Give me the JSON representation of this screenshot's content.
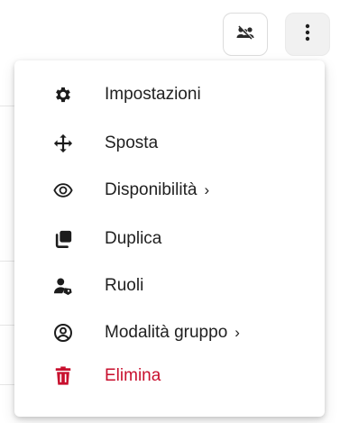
{
  "toolbar": {
    "groups_icon": "groups-off-icon",
    "more_icon": "more-vertical-icon"
  },
  "menu": {
    "items": [
      {
        "label": "Impostazioni",
        "icon": "gear-icon"
      },
      {
        "label": "Sposta",
        "icon": "move-icon"
      },
      {
        "label": "Disponibilità",
        "icon": "eye-icon",
        "chevron": "›"
      },
      {
        "label": "Duplica",
        "icon": "copy-icon"
      },
      {
        "label": "Ruoli",
        "icon": "user-roles-icon"
      },
      {
        "label": "Modalità gruppo",
        "icon": "account-circle-icon",
        "chevron": "›"
      },
      {
        "label": "Elimina",
        "icon": "trash-icon"
      }
    ]
  },
  "colors": {
    "text": "#212121",
    "danger": "#c8102e",
    "button_border": "#dcdcdc",
    "more_button_bg": "#f1f1f1"
  }
}
